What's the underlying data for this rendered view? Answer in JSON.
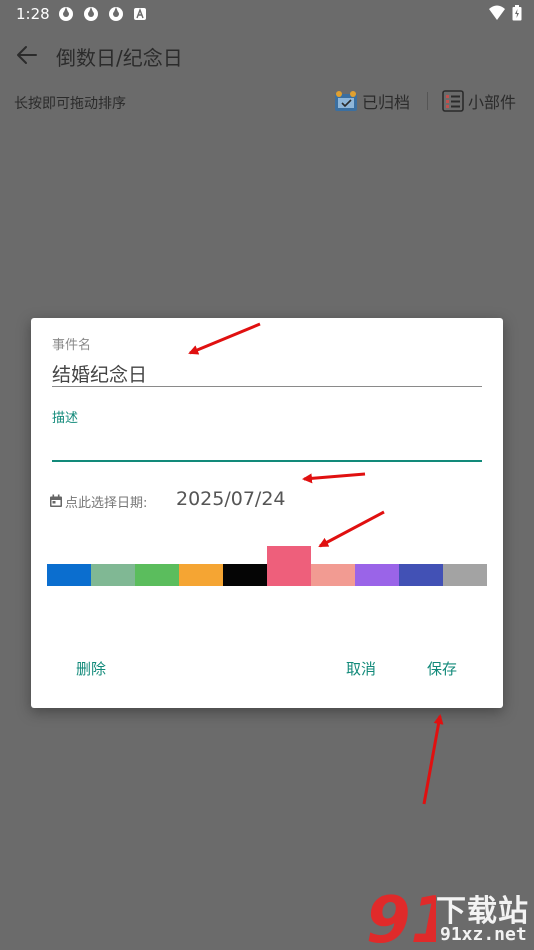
{
  "status_bar": {
    "time": "1:28"
  },
  "app_bar": {
    "title": "倒数日/纪念日"
  },
  "hint": {
    "text": "长按即可拖动排序"
  },
  "toolbar": {
    "archive_label": "已归档",
    "widget_label": "小部件"
  },
  "dialog": {
    "name_label": "事件名",
    "name_value": "结婚纪念日",
    "desc_label": "描述",
    "desc_value": "",
    "date_label": "点此选择日期:",
    "date_value": "2025/07/24",
    "colors": [
      "#0b6ecf",
      "#80b894",
      "#5bbd5d",
      "#f5a533",
      "#050505",
      "#ee5f7b",
      "#f29b92",
      "#9a64e8",
      "#4251b5",
      "#a3a3a3"
    ],
    "selected_color_index": 5,
    "delete_label": "删除",
    "cancel_label": "取消",
    "save_label": "保存"
  },
  "watermark": {
    "brand": "下载站",
    "domain": "91xz.net"
  }
}
